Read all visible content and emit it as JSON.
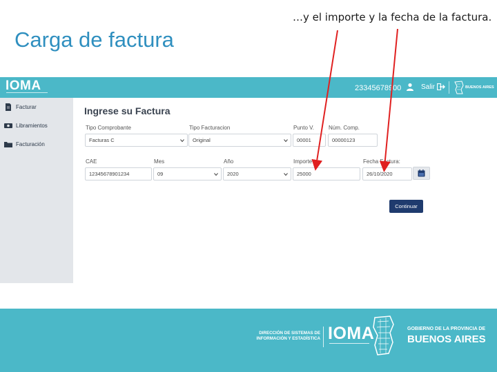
{
  "slide": {
    "title": "Carga de factura",
    "annotation": "…y el importe y la fecha de la factura."
  },
  "header": {
    "logo": "IOMA",
    "user_id": "23345678900",
    "logout_label": "Salir",
    "brand_logo_text": "BUENOS AIRES"
  },
  "sidebar": {
    "items": [
      {
        "label": "Facturar",
        "icon": "document-icon"
      },
      {
        "label": "Libramientos",
        "icon": "money-icon"
      },
      {
        "label": "Facturación",
        "icon": "folder-icon"
      }
    ]
  },
  "form": {
    "title": "Ingrese su Factura",
    "tipo_comprobante": {
      "label": "Tipo Comprobante",
      "value": "Facturas C"
    },
    "tipo_facturacion": {
      "label": "Tipo Facturacion",
      "value": "Original"
    },
    "punto_venta": {
      "label": "Punto V.",
      "value": "00001"
    },
    "num_comp": {
      "label": "Núm. Comp.",
      "value": "00000123"
    },
    "cae": {
      "label": "CAE",
      "value": "12345678901234"
    },
    "mes": {
      "label": "Mes",
      "value": "09"
    },
    "anio": {
      "label": "Año",
      "value": "2020"
    },
    "importe": {
      "label": "Importe",
      "value": "25000"
    },
    "fecha_factura": {
      "label": "Fecha Factura:",
      "value": "26/10/2020"
    },
    "continue_label": "Continuar"
  },
  "footer": {
    "dsie_line1": "DIRECCIÓN DE SISTEMAS DE",
    "dsie_line2": "INFORMACIÓN Y ESTADÍSTICA",
    "ioma": "IOMA",
    "gob_line": "GOBIERNO DE LA PROVINCIA DE",
    "ba_line": "BUENOS AIRES"
  },
  "colors": {
    "header": "#4bb8c8",
    "sidebar": "#e3e6ea",
    "button": "#1f3b6e",
    "title": "#2f8fbf",
    "arrow": "#e02020"
  }
}
